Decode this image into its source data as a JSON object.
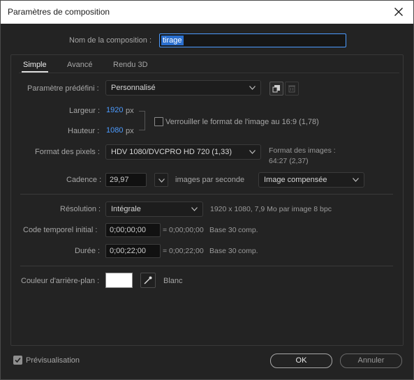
{
  "window": {
    "title": "Paramètres de composition",
    "close_icon": "close-icon"
  },
  "comp_name": {
    "label": "Nom de la composition :",
    "value": "tirage"
  },
  "tabs": [
    {
      "label": "Simple",
      "active": true
    },
    {
      "label": "Avancé",
      "active": false
    },
    {
      "label": "Rendu 3D",
      "active": false
    }
  ],
  "preset": {
    "label": "Paramètre prédéfini :",
    "value": "Personnalisé"
  },
  "width": {
    "label": "Largeur :",
    "value": "1920",
    "unit": "px"
  },
  "height": {
    "label": "Hauteur :",
    "value": "1080",
    "unit": "px"
  },
  "lock_ratio": {
    "label": "Verrouiller le format de l'image au 16:9 (1,78)",
    "checked": false
  },
  "pixel_format": {
    "label": "Format des pixels :",
    "value": "HDV 1080/DVCPRO HD 720 (1,33)"
  },
  "frame_aspect": {
    "label": "Format des images :",
    "value": "64:27 (2,37)"
  },
  "frame_rate": {
    "label": "Cadence :",
    "value": "29,97",
    "unit": "images par seconde",
    "mode": "Image compensée"
  },
  "resolution": {
    "label": "Résolution :",
    "value": "Intégrale",
    "info": "1920 x 1080, 7,9 Mo par image 8 bpc"
  },
  "start_timecode": {
    "label": "Code temporel initial :",
    "value": "0;00;00;00",
    "equals": "= 0;00;00;00",
    "base": "Base 30",
    "comp": "comp."
  },
  "duration": {
    "label": "Durée :",
    "value": "0;00;22;00",
    "equals": "= 0;00;22;00",
    "base": "Base 30",
    "comp": "comp."
  },
  "background": {
    "label": "Couleur d'arrière-plan :",
    "color": "#ffffff",
    "color_name": "Blanc"
  },
  "preview": {
    "label": "Prévisualisation",
    "checked": true
  },
  "buttons": {
    "ok": "OK",
    "cancel": "Annuler"
  },
  "colors": {
    "accent": "#4c9bff",
    "dialog_bg": "#232323",
    "field_bg": "#111111"
  }
}
